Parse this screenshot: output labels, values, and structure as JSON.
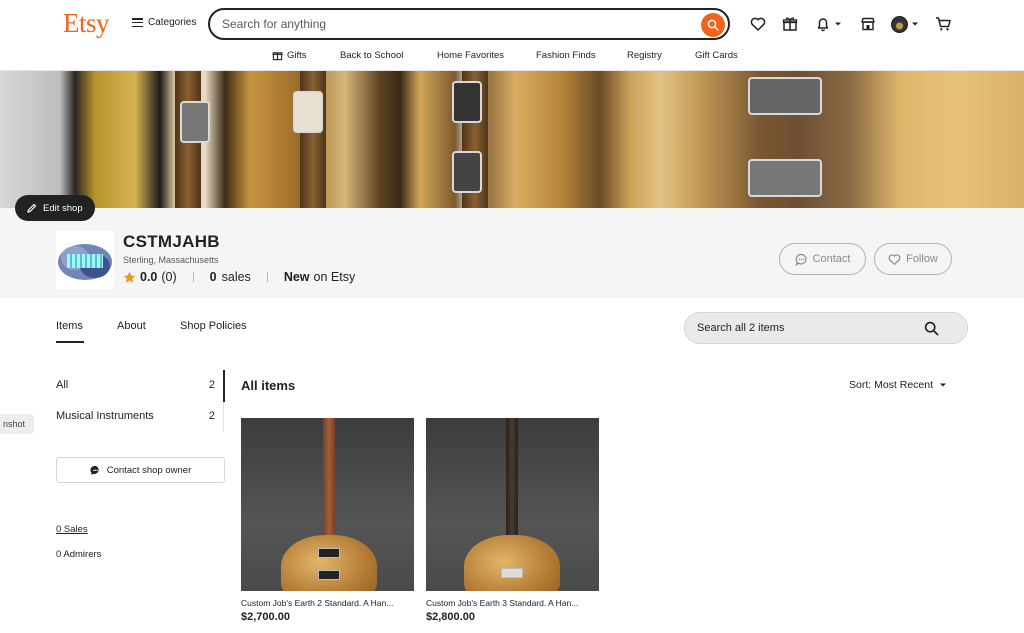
{
  "header": {
    "logo": "Etsy",
    "categories_label": "Categories",
    "search_placeholder": "Search for anything"
  },
  "subnav": [
    "Gifts",
    "Back to School",
    "Home Favorites",
    "Fashion Finds",
    "Registry",
    "Gift Cards"
  ],
  "banner": {
    "edit_label": "Edit shop"
  },
  "shop": {
    "name": "CSTMJAHB",
    "location": "Sterling, Massachusetts",
    "rating": "0.0",
    "reviews": "(0)",
    "sales_count": "0",
    "sales_label": "sales",
    "new_label": "New",
    "on_etsy_label": "on Etsy",
    "contact_label": "Contact",
    "follow_label": "Follow"
  },
  "tabs": [
    "Items",
    "About",
    "Shop Policies"
  ],
  "shop_search_placeholder": "Search all 2 items",
  "sidebar": {
    "categories": [
      {
        "label": "All",
        "count": "2"
      },
      {
        "label": "Musical Instruments",
        "count": "2"
      }
    ],
    "contact_owner": "Contact shop owner",
    "sales_link": "0 Sales",
    "admirers": "0 Admirers"
  },
  "screenshot_tag": "nshot",
  "main": {
    "heading": "All items",
    "sort_label": "Sort: Most Recent",
    "listings": [
      {
        "title": "Custom Job's Earth 2 Standard. A Han...",
        "price": "$2,700.00"
      },
      {
        "title": "Custom Job's Earth 3 Standard. A Han...",
        "price": "$2,800.00"
      }
    ]
  },
  "colors": {
    "brand": "#f1641e",
    "text": "#222222",
    "band": "#f5f5f5"
  }
}
